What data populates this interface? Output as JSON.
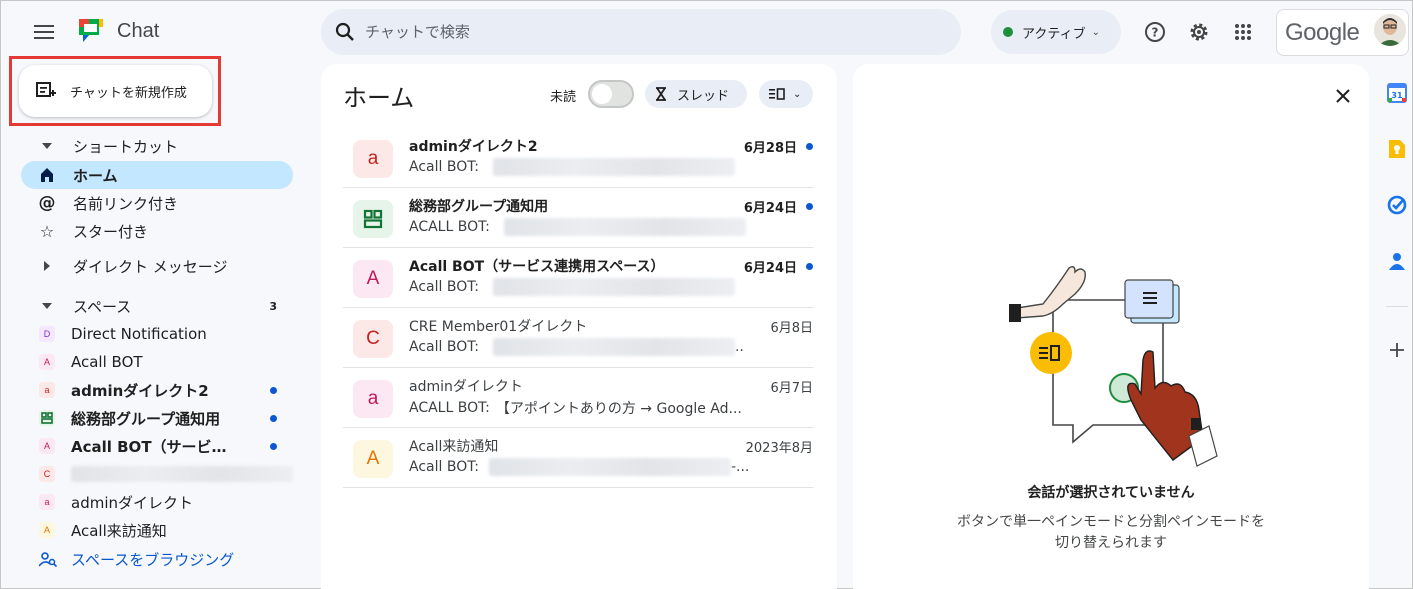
{
  "header": {
    "app_name": "Chat",
    "search_placeholder": "チャットで検索",
    "status_label": "アクティブ",
    "brand_word": "Google"
  },
  "sidebar": {
    "new_chat_label": "チャットを新規作成",
    "shortcuts_label": "ショートカット",
    "home_label": "ホーム",
    "mentions_label": "名前リンク付き",
    "starred_label": "スター付き",
    "dm_label": "ダイレクト メッセージ",
    "spaces_label": "スペース",
    "spaces_count": "3",
    "spaces": [
      {
        "initial": "D",
        "name": "Direct Notification",
        "bold": false,
        "unread": false
      },
      {
        "initial": "A",
        "name": "Acall BOT",
        "bold": false,
        "unread": false
      },
      {
        "initial": "a",
        "name": "adminダイレクト2",
        "bold": true,
        "unread": true
      },
      {
        "initial": "",
        "name": "総務部グループ通知用",
        "bold": true,
        "unread": true
      },
      {
        "initial": "A",
        "name": "Acall BOT（サービス...",
        "bold": true,
        "unread": true
      },
      {
        "initial": "C",
        "name": "",
        "bold": false,
        "unread": false
      },
      {
        "initial": "a",
        "name": "adminダイレクト",
        "bold": false,
        "unread": false
      },
      {
        "initial": "A",
        "name": "Acall来訪通知",
        "bold": false,
        "unread": false
      }
    ],
    "browse_label": "スペースをブラウジング"
  },
  "home": {
    "title": "ホーム",
    "unread_label": "未読",
    "thread_label": "スレッド",
    "conversations": [
      {
        "initial": "a",
        "name": "adminダイレクト2",
        "sender": "Acall BOT:",
        "snippet": "",
        "date": "6月28日",
        "unread": true
      },
      {
        "initial": "",
        "name": "総務部グループ通知用",
        "sender": "ACALL BOT:",
        "snippet": "",
        "date": "6月24日",
        "unread": true
      },
      {
        "initial": "A",
        "name": "Acall BOT（サービス連携用スペース）",
        "sender": "Acall BOT:",
        "snippet": "",
        "date": "6月24日",
        "unread": true
      },
      {
        "initial": "C",
        "name": "CRE Member01ダイレクト",
        "sender": "Acall BOT:",
        "snippet": "..",
        "date": "6月8日",
        "unread": false
      },
      {
        "initial": "a",
        "name": "adminダイレクト",
        "sender": "ACALL BOT:",
        "snippet": "【アポイントありの方 → Google Ad...",
        "date": "6月7日",
        "unread": false
      },
      {
        "initial": "A",
        "name": "Acall来訪通知",
        "sender": "Acall BOT:",
        "snippet": "-...",
        "date": "2023年8月",
        "unread": false
      }
    ]
  },
  "empty_state": {
    "title": "会話が選択されていません",
    "description": "ボタンで単一ペインモードと分割ペインモードを切り替えられます"
  },
  "colors": {
    "accent": "#0b57d0",
    "active_nav": "#c2e7ff",
    "highlight_border": "#e53935",
    "status_green": "#1e8e3e"
  }
}
